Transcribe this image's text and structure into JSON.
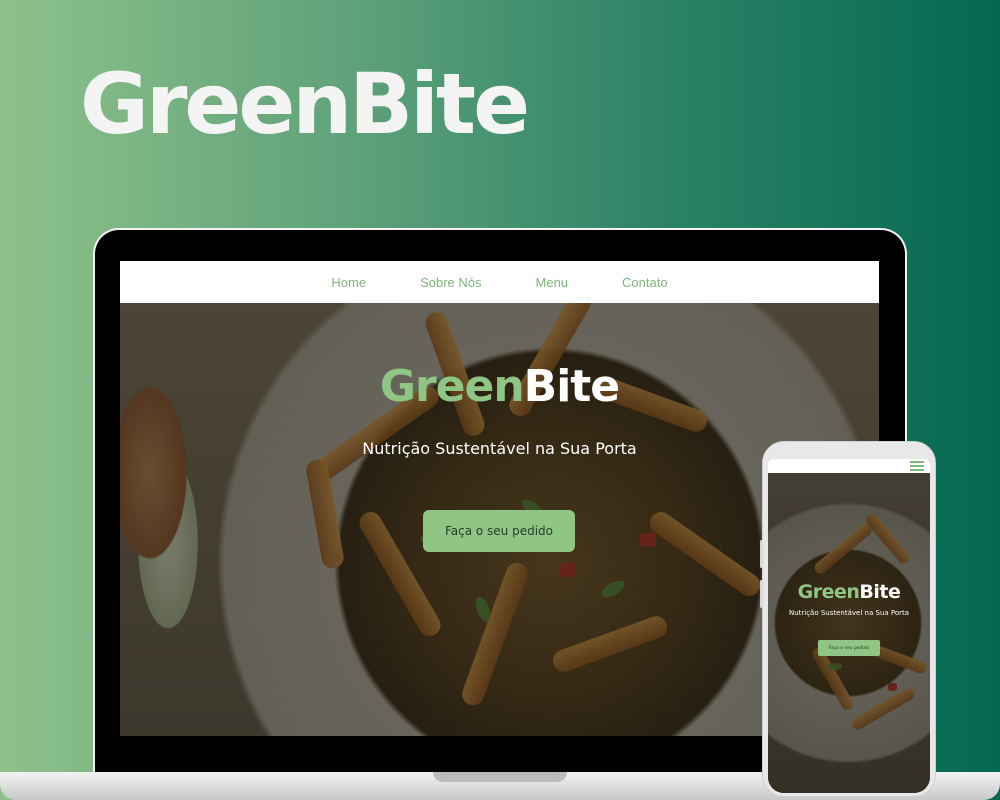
{
  "brand": {
    "title": "GreenBite"
  },
  "laptop_site": {
    "nav": [
      "Home",
      "Sobre Nós",
      "Menu",
      "Contato"
    ],
    "hero": {
      "title_part1": "Green",
      "title_part2": "Bite",
      "subtitle": "Nutrição Sustentável na Sua Porta",
      "cta_label": "Faça o seu pedido"
    }
  },
  "phone_site": {
    "menu_icon": "hamburger-menu-icon",
    "hero": {
      "title_part1": "Green",
      "title_part2": "Bite",
      "subtitle": "Nutrição Sustentável na Sua Porta",
      "cta_label": "Faça o seu pedido"
    }
  },
  "colors": {
    "brand_green": "#8fc585",
    "nav_text": "#7fb679",
    "background_start": "#8ec18a",
    "background_end": "#03684f"
  }
}
